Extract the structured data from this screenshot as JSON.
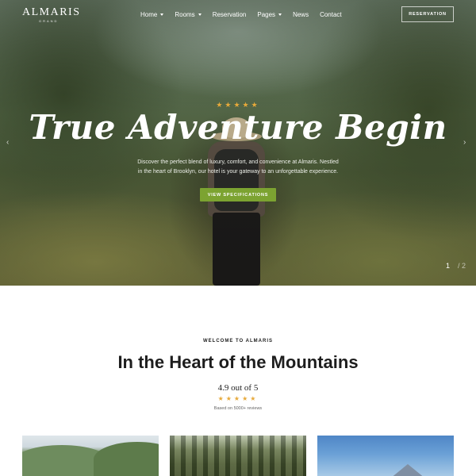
{
  "brand": {
    "name": "ALMARIS",
    "tagline": "GRAND"
  },
  "nav": {
    "items": [
      {
        "label": "Home",
        "dropdown": true
      },
      {
        "label": "Rooms",
        "dropdown": true
      },
      {
        "label": "Reservation",
        "dropdown": false
      },
      {
        "label": "Pages",
        "dropdown": true
      },
      {
        "label": "News",
        "dropdown": false
      },
      {
        "label": "Contact",
        "dropdown": false
      }
    ],
    "reservation_button": "RESERVATION"
  },
  "hero": {
    "stars": "★★★★★",
    "title": "True Adventure Begin",
    "description_line1": "Discover the perfect blend of luxury, comfort, and convenience at Almaris. Nestled",
    "description_line2": "in the heart of Brooklyn, our hotel is your gateway to an unforgettable experience.",
    "cta_label": "VIEW SPECIFICATIONS",
    "prev_icon": "chevron-left-icon",
    "next_icon": "chevron-right-icon",
    "slide_current": "1",
    "slide_total": "/ 2"
  },
  "welcome": {
    "eyebrow": "WELCOME TO ALMARIS",
    "heading": "In the Heart of the Mountains",
    "rating": "4.9 out of 5",
    "stars": "★★★★★",
    "reviews": "Based on 5000+ reviews"
  },
  "colors": {
    "accent_green": "#7ca331",
    "star_gold": "#e7a93a"
  }
}
